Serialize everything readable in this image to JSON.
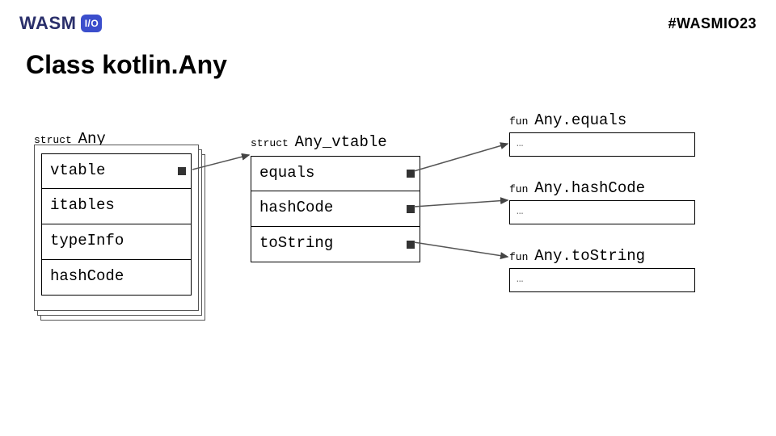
{
  "header": {
    "logo_text": "WASM",
    "logo_badge": "I/O",
    "hashtag": "#WASMIO23"
  },
  "title": "Class kotlin.Any",
  "struct_any": {
    "prefix": "struct",
    "name": "Any",
    "fields": [
      "vtable",
      "itables",
      "typeInfo",
      "hashCode"
    ]
  },
  "struct_vtable": {
    "prefix": "struct",
    "name": "Any_vtable",
    "fields": [
      "equals",
      "hashCode",
      "toString"
    ]
  },
  "functions": [
    {
      "prefix": "fun",
      "name": "Any.equals",
      "body": "…"
    },
    {
      "prefix": "fun",
      "name": "Any.hashCode",
      "body": "…"
    },
    {
      "prefix": "fun",
      "name": "Any.toString",
      "body": "…"
    }
  ]
}
